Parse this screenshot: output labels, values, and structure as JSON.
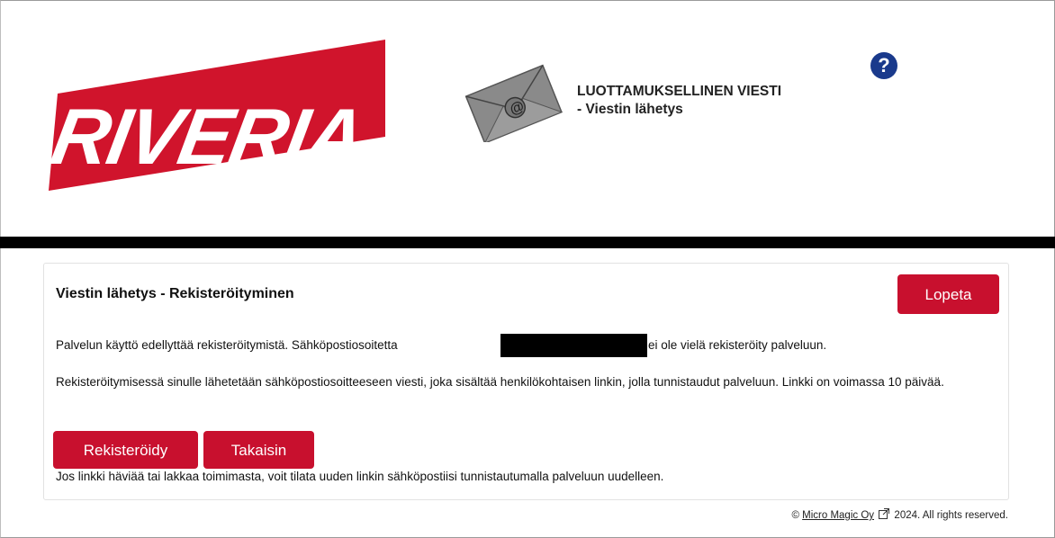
{
  "header": {
    "logo_text": "RIVERIA",
    "title_line1": "LUOTTAMUKSELLINEN VIESTI",
    "title_line2": "- Viestin lähetys",
    "help_glyph": "?"
  },
  "card": {
    "title": "Viestin lähetys - Rekisteröityminen",
    "logout_label": "Lopeta",
    "paragraph1_start": "Palvelun käyttö edellyttää rekisteröitymistä. Sähköpostiosoitetta",
    "paragraph1_end": "ei ole vielä rekisteröity palveluun.",
    "paragraph2": "Rekisteröitymisessä sinulle lähetetään sähköpostiosoitteeseen viesti, joka sisältää henkilökohtaisen linkin, jolla tunnistaudut palveluun. Linkki on voimassa 10 päivää.",
    "register_label": "Rekisteröidy",
    "back_label": "Takaisin",
    "paragraph3": "Jos linkki häviää tai lakkaa toimimasta, voit tilata uuden linkin sähköpostiisi tunnistautumalla palveluun uudelleen."
  },
  "footer": {
    "copyright_symbol": "©",
    "company_link": "Micro Magic Oy",
    "suffix": "2024. All rights reserved."
  },
  "icons": {
    "help": "question-circle-icon",
    "envelope": "envelope-at-icon",
    "external": "external-link-icon"
  },
  "colors": {
    "brand_red": "#c8102e",
    "help_blue": "#1a3a8c"
  }
}
